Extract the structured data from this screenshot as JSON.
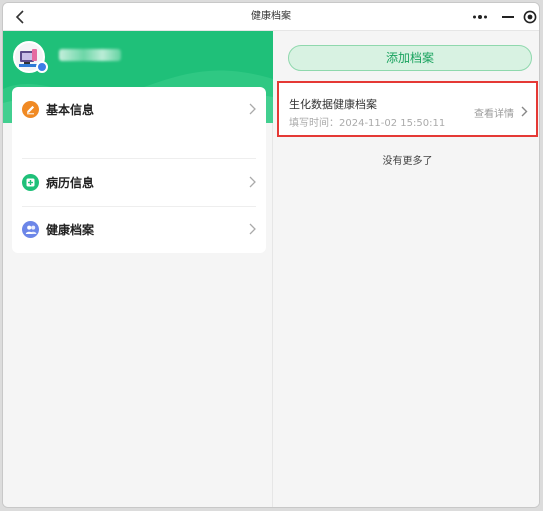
{
  "window": {
    "title": "健康档案"
  },
  "profile": {
    "username": "",
    "accent_color": "#1fc079"
  },
  "menu": {
    "items": [
      {
        "label": "基本信息",
        "icon": "edit-icon",
        "icon_color": "#f08a24"
      },
      {
        "label": "病历信息",
        "icon": "medical-record-icon",
        "icon_color": "#1fc079"
      },
      {
        "label": "健康档案",
        "icon": "people-icon",
        "icon_color": "#6c86e8"
      }
    ]
  },
  "main": {
    "add_button_label": "添加档案",
    "records": [
      {
        "title": "生化数据健康档案",
        "time": "填写时间：2024-11-02 15:50:11",
        "detail_label": "查看详情"
      }
    ],
    "footer_text": "没有更多了"
  }
}
